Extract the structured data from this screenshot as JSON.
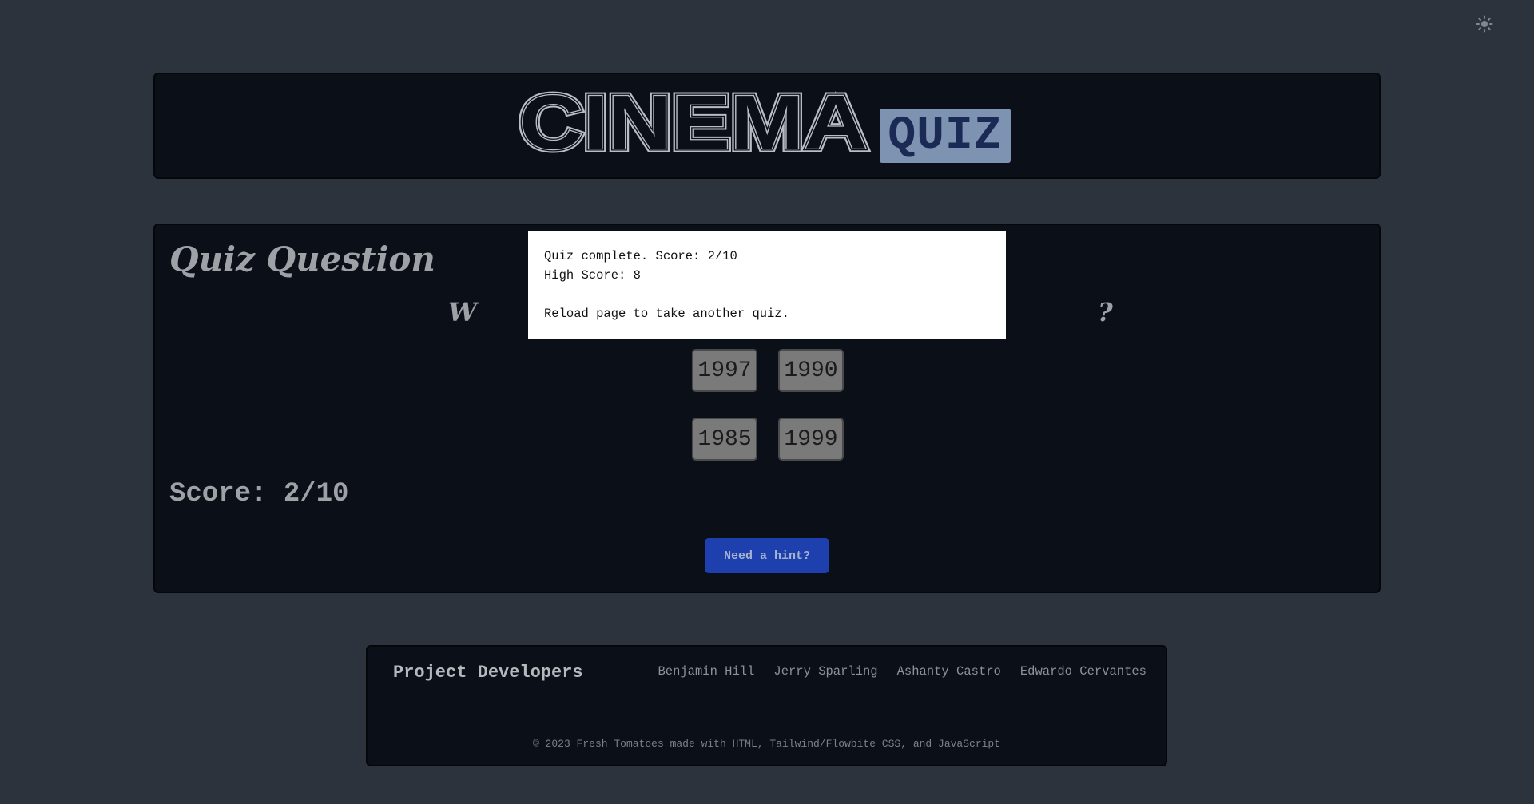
{
  "header": {
    "logo_text": "CINEMA",
    "badge_text": "QUIZ",
    "theme_toggle_icon": "sun-icon"
  },
  "quiz": {
    "title": "Quiz Question",
    "question_visible_start": "W",
    "question_visible_end": "?",
    "answers": [
      "1997",
      "1990",
      "1985",
      "1999"
    ],
    "score": "Score: 2/10",
    "hint_button": "Need a hint?"
  },
  "modal": {
    "line1": "Quiz complete. Score: 2/10",
    "line2": "High Score: 8",
    "line3": "Reload page to take another quiz."
  },
  "footer": {
    "title": "Project Developers",
    "developers": [
      "Benjamin Hill",
      "Jerry Sparling",
      "Ashanty Castro",
      "Edwardo Cervantes"
    ],
    "copyright": "© 2023 Fresh Tomatoes made with HTML, Tailwind/Flowbite CSS, and JavaScript"
  },
  "colors": {
    "page_bg": "#2d333c",
    "panel_bg": "#0b0f17",
    "badge_bg": "#7e93b1",
    "hint_bg": "#1e40af"
  }
}
